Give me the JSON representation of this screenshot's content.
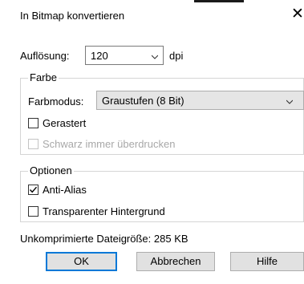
{
  "dialog": {
    "title": "In Bitmap konvertieren"
  },
  "resolution": {
    "label": "Auflösung:",
    "value": "120",
    "unit": "dpi"
  },
  "color_group": {
    "legend": "Farbe",
    "mode_label": "Farbmodus:",
    "mode_value": "Graustufen (8 Bit)",
    "dithered": {
      "label": "Gerastert",
      "checked": false
    },
    "overprint_black": {
      "label": "Schwarz immer überdrucken",
      "checked": false,
      "disabled": true
    }
  },
  "options_group": {
    "legend": "Optionen",
    "anti_alias": {
      "label": "Anti-Alias",
      "checked": true
    },
    "transparent_bg": {
      "label": "Transparenter Hintergrund",
      "checked": false
    }
  },
  "uncompressed_size": "Unkomprimierte Dateigröße: 285 KB",
  "buttons": {
    "ok": "OK",
    "cancel": "Abbrechen",
    "help": "Hilfe"
  },
  "colors": {
    "default_button_border": "#0078d7",
    "button_face": "#e1e1e1",
    "disabled_text": "#a8a8a8"
  }
}
